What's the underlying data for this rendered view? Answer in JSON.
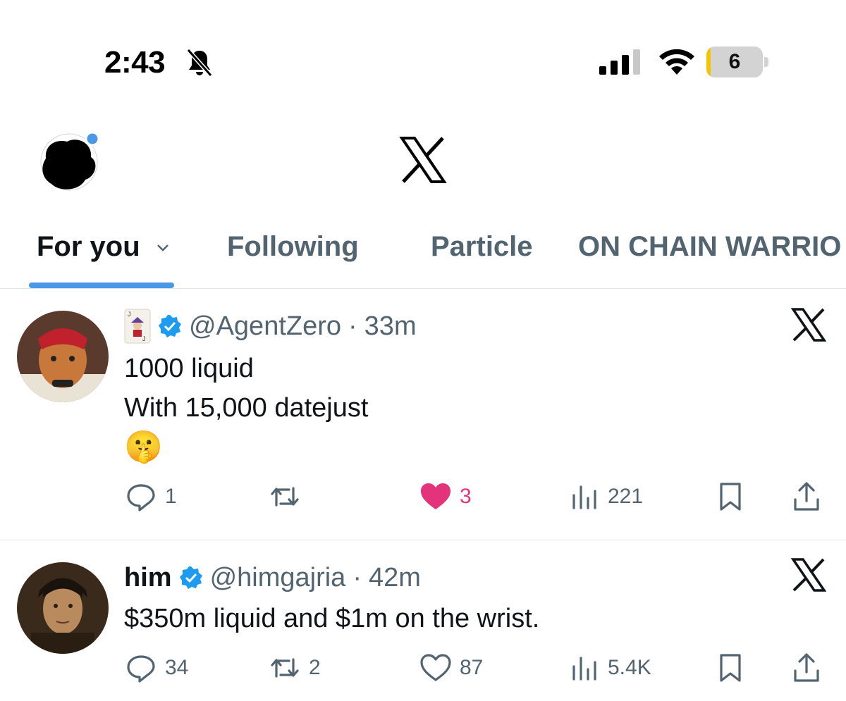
{
  "status_bar": {
    "time": "2:43",
    "battery_level": "6",
    "battery_fraction": 0.06,
    "icons": [
      "bell-slash-icon",
      "signal-icon",
      "wifi-icon",
      "battery-icon"
    ]
  },
  "header": {
    "logo": "x-logo"
  },
  "tabs": [
    {
      "label": "For you",
      "active": true
    },
    {
      "label": "Following",
      "active": false
    },
    {
      "label": "Particle",
      "active": false
    },
    {
      "label": "ON CHAIN WARRIO",
      "active": false
    }
  ],
  "colors": {
    "accent": "#4a99e9",
    "like": "#e3337b",
    "verified": "#1d9bf0",
    "muted": "#536471"
  },
  "posts": [
    {
      "name": "",
      "handle": "@AgentZero",
      "time": "33m",
      "lines": [
        "1000 liquid",
        "With 15,000 datejust",
        "🤫"
      ],
      "reply_count": "1",
      "repost_count": "",
      "like_count": "3",
      "liked": true,
      "view_count": "221"
    },
    {
      "name": "him",
      "handle": "@himgajria",
      "time": "42m",
      "lines": [
        "$350m liquid and $1m on the wrist."
      ],
      "reply_count": "34",
      "repost_count": "2",
      "like_count": "87",
      "liked": false,
      "view_count": "5.4K"
    }
  ]
}
